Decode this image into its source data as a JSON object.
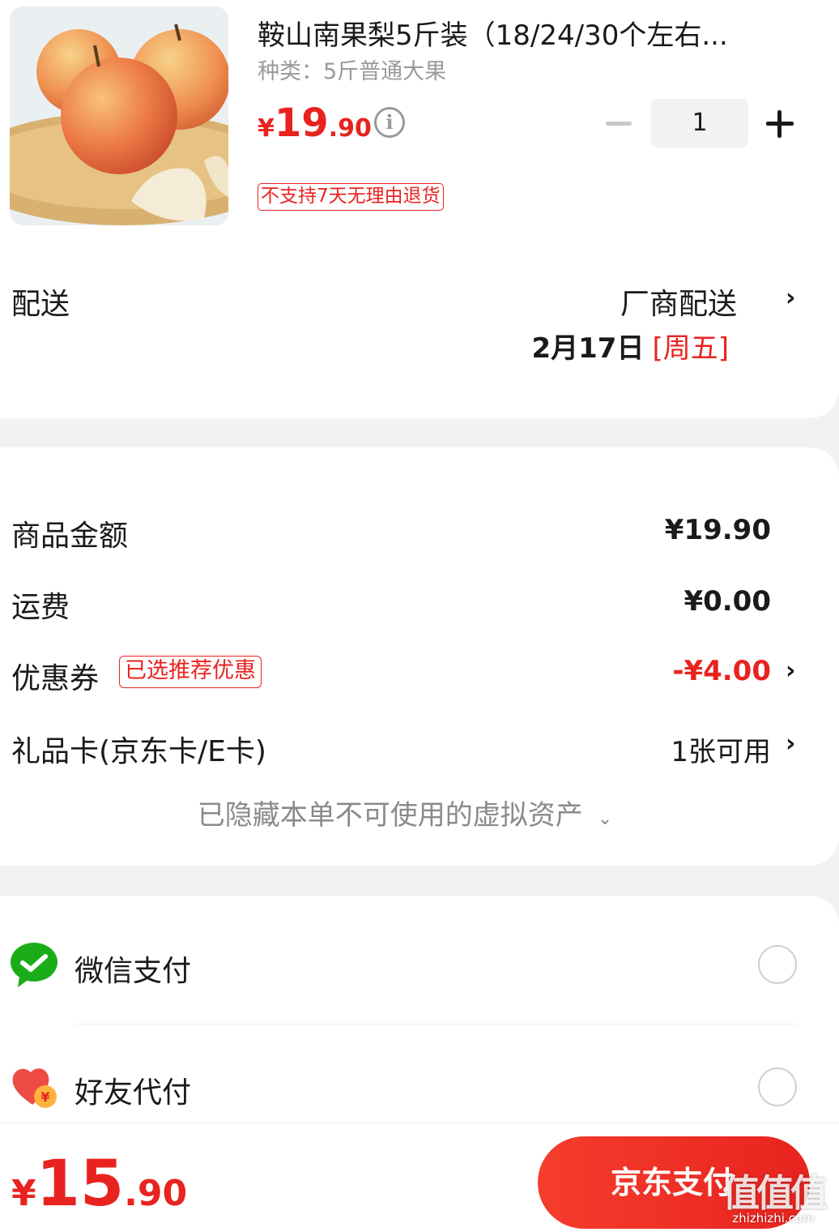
{
  "product": {
    "title": "鞍山南果梨5斤装（18/24/30个左右...",
    "variant": "种类：5斤普通大果",
    "price_currency": "¥",
    "price_int": "19",
    "price_dec": ".90",
    "quantity": "1",
    "return_policy": "不支持7天无理由退货"
  },
  "shipping": {
    "label": "配送",
    "method": "厂商配送",
    "date": "2月17日",
    "weekday": "[周五]"
  },
  "costs": {
    "goods_label": "商品金额",
    "goods_value": "¥19.90",
    "freight_label": "运费",
    "freight_value": "¥0.00",
    "coupon_label": "优惠券",
    "coupon_tag": "已选推荐优惠",
    "coupon_value": "-¥4.00",
    "giftcard_label": "礼品卡(京东卡/E卡)",
    "giftcard_value": "1张可用",
    "hidden_assets": "已隐藏本单不可使用的虚拟资产"
  },
  "payment": {
    "wechat_label": "微信支付",
    "friend_label": "好友代付"
  },
  "footer": {
    "total_currency": "¥",
    "total_int": "15",
    "total_dec": ".90",
    "pay_button": "京东支付",
    "watermark": "值值值",
    "watermark_sub": "zhizhizhi.com"
  },
  "colors": {
    "accent": "#e8231f",
    "wechat": "#1aad19"
  }
}
